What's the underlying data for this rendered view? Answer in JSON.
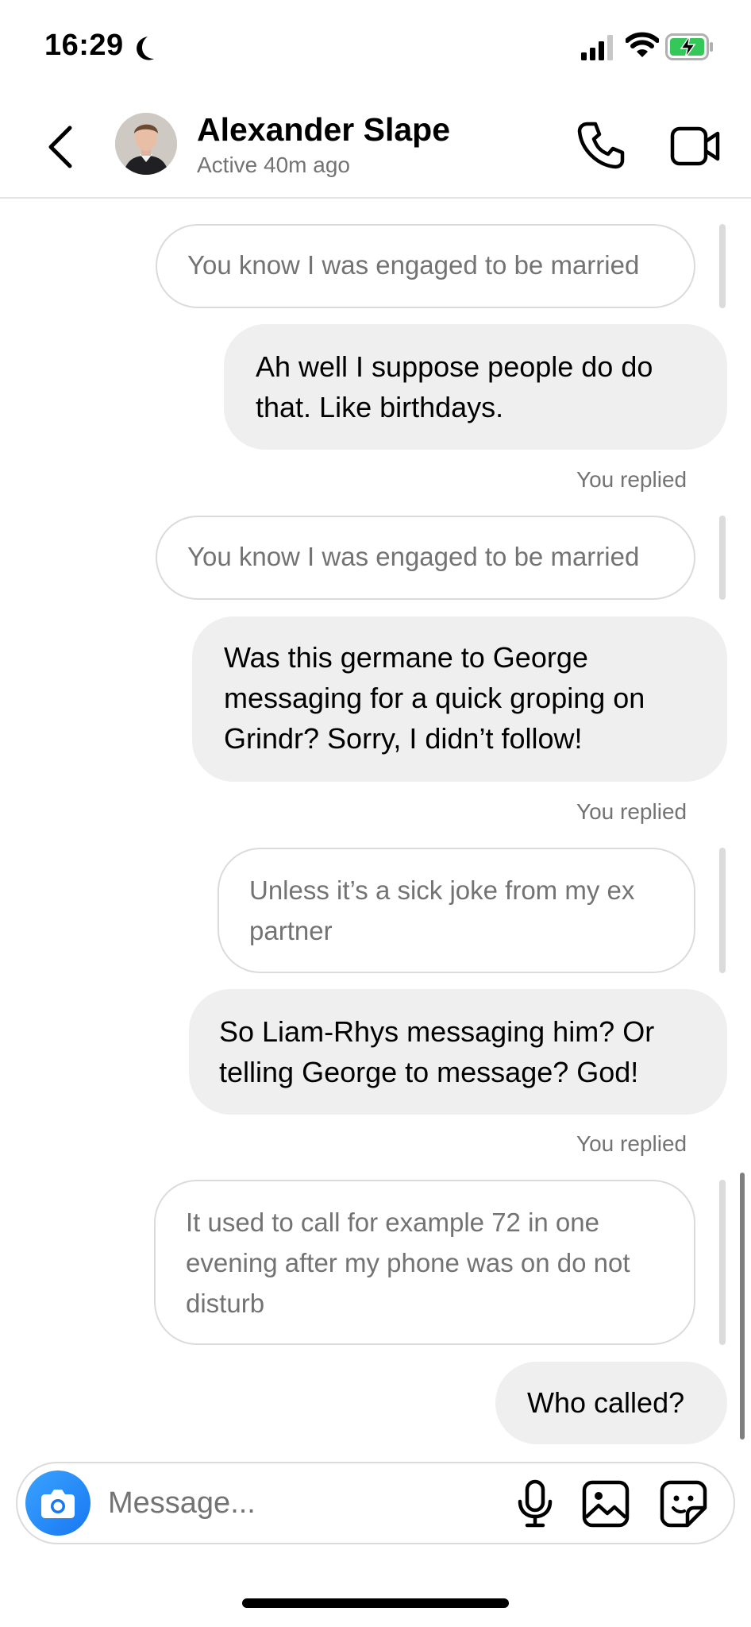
{
  "status_bar": {
    "time": "16:29",
    "icons": [
      "moon-icon",
      "signal-icon",
      "wifi-icon",
      "battery-charging-icon"
    ]
  },
  "header": {
    "name": "Alexander Slape",
    "status": "Active 40m ago",
    "icons": [
      "back-chevron-icon",
      "phone-icon",
      "video-camera-icon"
    ]
  },
  "messages": [
    {
      "type": "quote",
      "text": "You know I was engaged to be married"
    },
    {
      "type": "sent",
      "text": "Ah well I suppose people do do that. Like birthdays."
    },
    {
      "type": "label",
      "text": "You replied"
    },
    {
      "type": "quote",
      "text": "You know I was engaged to be married"
    },
    {
      "type": "sent",
      "text": "Was this germane to George messaging for a quick groping on Grindr? Sorry, I didn’t follow!"
    },
    {
      "type": "label",
      "text": "You replied"
    },
    {
      "type": "quote",
      "text": "Unless it’s a sick joke from my ex partner"
    },
    {
      "type": "sent",
      "text": "So Liam-Rhys messaging him? Or telling George to message? God!"
    },
    {
      "type": "label",
      "text": "You replied"
    },
    {
      "type": "quote",
      "text": "It used to call for example 72 in one evening after my phone was on do not disturb"
    },
    {
      "type": "sent",
      "text": "Who called?"
    }
  ],
  "composer": {
    "placeholder": "Message...",
    "icons": [
      "camera-icon",
      "microphone-icon",
      "image-icon",
      "sticker-icon"
    ]
  },
  "colors": {
    "bubble": "#efefef",
    "quote_border": "#dbdbdb",
    "secondary_text": "#737373",
    "camera_button": "#1877f2",
    "battery_charge": "#34c759"
  }
}
